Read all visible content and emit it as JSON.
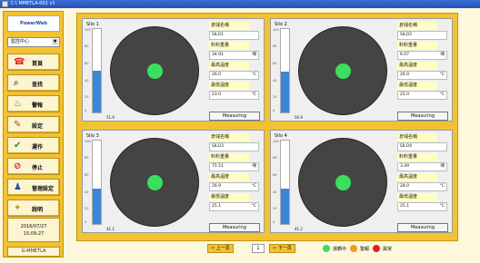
{
  "window": {
    "title": "C:\\ MMETLA-001 v1"
  },
  "sidebar": {
    "logo_text": "PowerWeb",
    "select_value": "監控中心",
    "nav": [
      {
        "label": "首頁",
        "icon": "phone-icon"
      },
      {
        "label": "查找",
        "icon": "search-icon"
      },
      {
        "label": "警報",
        "icon": "alarm-icon"
      },
      {
        "label": "設定",
        "icon": "settings-icon"
      },
      {
        "label": "運作",
        "icon": "check-icon"
      },
      {
        "label": "停止",
        "icon": "stop-icon"
      },
      {
        "label": "管理設定",
        "icon": "user-icon"
      },
      {
        "label": "說明",
        "icon": "help-icon"
      }
    ],
    "date": "2016/07/27",
    "time": "15:09:27",
    "brand": "G-MMETLA"
  },
  "panels": [
    {
      "name": "Silo 1",
      "gauge_fraction": 0.5,
      "level": "51.9",
      "labels": [
        "倉儲名稱",
        "料料重量",
        "最高溫度",
        "最低溫度"
      ],
      "values": [
        "SILO1",
        "34.91",
        "26.0",
        "23.0"
      ],
      "units": [
        "",
        "噸",
        "°C",
        "°C"
      ],
      "button": "Measuring"
    },
    {
      "name": "Silo 2",
      "gauge_fraction": 0.49,
      "level": "50.9",
      "labels": [
        "倉儲名稱",
        "料料重量",
        "最高溫度",
        "最低溫度"
      ],
      "values": [
        "SILO2",
        "6.07",
        "26.0",
        "25.0"
      ],
      "units": [
        "",
        "噸",
        "°C",
        "°C"
      ],
      "button": "Measuring"
    },
    {
      "name": "Silo 3",
      "gauge_fraction": 0.42,
      "level": "41.1",
      "labels": [
        "倉儲名稱",
        "料料重量",
        "最高溫度",
        "最低溫度"
      ],
      "values": [
        "SILO3",
        "75.51",
        "26.9",
        "25.1"
      ],
      "units": [
        "",
        "噸",
        "°C",
        "°C"
      ],
      "button": "Measuring"
    },
    {
      "name": "Silo 4",
      "gauge_fraction": 0.42,
      "level": "41.2",
      "labels": [
        "倉儲名稱",
        "料料重量",
        "最高溫度",
        "最低溫度"
      ],
      "values": [
        "SILO4",
        "3.49",
        "28.0",
        "25.1"
      ],
      "units": [
        "",
        "噸",
        "°C",
        "°C"
      ],
      "button": "Measuring"
    }
  ],
  "gauge_ticks": [
    "100",
    "80",
    "60",
    "40",
    "20",
    "0"
  ],
  "pager": {
    "prev": "上一頁",
    "page": "1",
    "next": "下一頁"
  },
  "legend": [
    {
      "label": "運轉中",
      "color": "#3ae05c"
    },
    {
      "label": "警報",
      "color": "#f59a16"
    },
    {
      "label": "異常",
      "color": "#e02020"
    }
  ],
  "colors": {
    "sidebar": "#f2c233",
    "gauge": "#3b86d9",
    "status_ok": "#3ae05c"
  }
}
